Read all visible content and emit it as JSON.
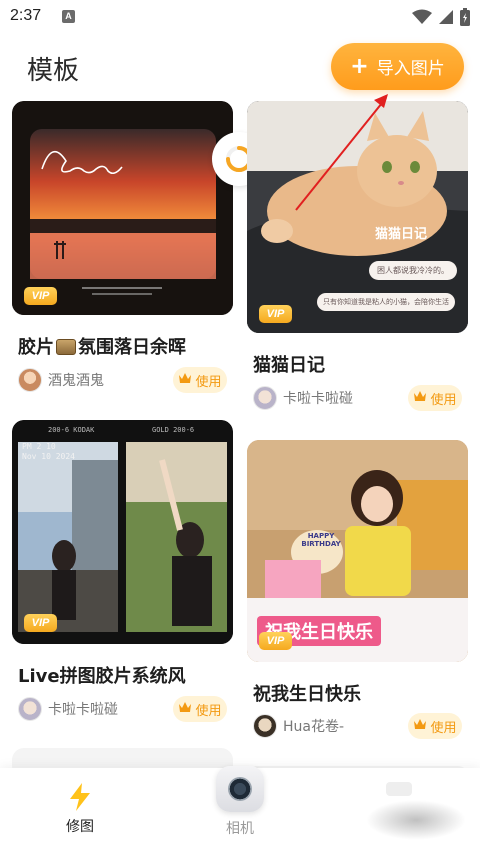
{
  "status_bar": {
    "time": "2:37",
    "indicator": "A"
  },
  "header": {
    "title": "模板",
    "import_button": {
      "plus": "+",
      "label": "导入图片"
    }
  },
  "cards": [
    {
      "title": "胶片📜氛围落日余晖",
      "title_main": "胶片",
      "title_rest": "氛围落日余晖",
      "vip": "VIP",
      "thumb_text": "Leaving",
      "author": "酒鬼酒鬼",
      "use_label": "使用"
    },
    {
      "title": "猫猫日记",
      "vip": "VIP",
      "thumb_heading": "猫猫日记",
      "bubble_1": "困人都说我冷冷的。",
      "bubble_2": "只有你知道我是粘人的小猫，会陪你生活",
      "author": "卡啦卡啦碰",
      "use_label": "使用"
    },
    {
      "title": "Live拼图胶片系统风",
      "vip": "VIP",
      "date_stamp_1": "PM 2 10",
      "date_stamp_2": "Nov 10 2024",
      "film_label_1": "200-6  KODAK",
      "film_label_2": "GOLD 200-6",
      "author": "卡啦卡啦碰",
      "use_label": "使用"
    },
    {
      "title": "祝我生日快乐",
      "vip": "VIP",
      "banner_text": "祝我生日快乐",
      "cake_text": "HAPPY BIRTHDAY",
      "author": "Hua花卷-",
      "use_label": "使用"
    }
  ],
  "bottom_nav": {
    "items": [
      {
        "label": "修图",
        "active": true
      },
      {
        "label": "相机",
        "active": false
      }
    ]
  },
  "colors": {
    "accent": "#ff9f22",
    "accent_light": "#fff3d6",
    "text": "#1e1e1e",
    "muted": "#777777"
  }
}
